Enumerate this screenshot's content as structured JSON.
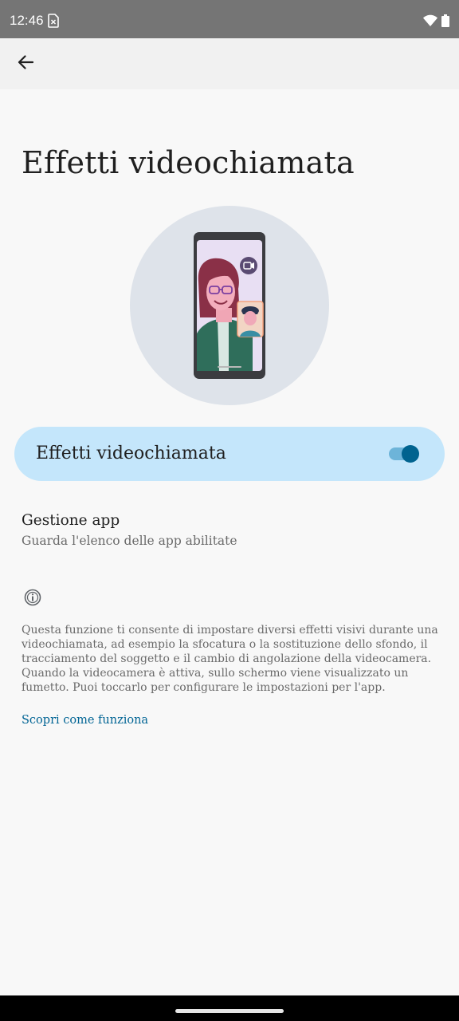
{
  "status_bar": {
    "time": "12:46"
  },
  "icons": {
    "back": "arrow-back-icon",
    "sim": "sim-card-icon",
    "wifi": "wifi-icon",
    "battery": "battery-icon",
    "info": "info-icon"
  },
  "page": {
    "title": "Effetti videochiamata"
  },
  "toggle": {
    "label": "Effetti videochiamata",
    "checked": true
  },
  "app_management": {
    "title": "Gestione app",
    "summary": "Guarda l'elenco delle app abilitate"
  },
  "footer": {
    "description": "Questa funzione ti consente di impostare diversi effetti visivi durante una videochiamata, ad esempio la sfocatura o la sostituzione dello sfondo, il tracciamento del soggetto e il cambio di angolazione della videocamera. Quando la videocamera è attiva, sullo schermo viene visualizzato un fumetto. Puoi toccarlo per configurare le impostazioni per l'app.",
    "link": "Scopri come funziona"
  },
  "colors": {
    "accent": "#00638f",
    "card": "#c4e6fb",
    "background": "#f8f8f8"
  }
}
